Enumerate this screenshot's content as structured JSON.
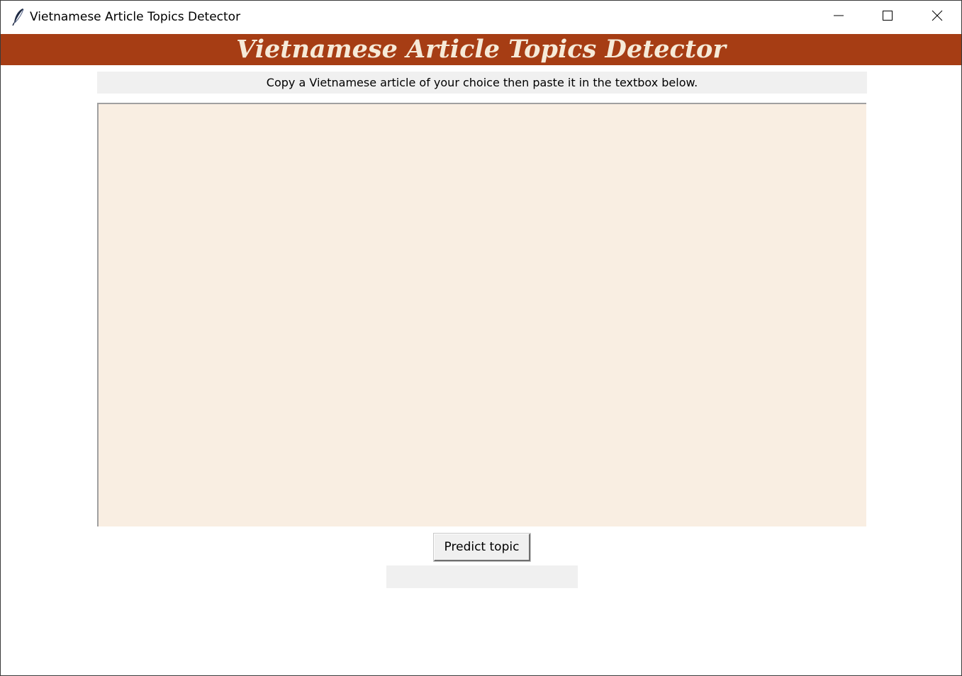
{
  "window": {
    "title": "Vietnamese Article Topics Detector",
    "icon": "feather-icon",
    "controls": {
      "minimize_icon": "minimize-icon",
      "maximize_icon": "maximize-icon",
      "close_icon": "close-icon"
    }
  },
  "header": {
    "banner_text": "Vietnamese Article Topics Detector",
    "banner_color": "#a63d14",
    "banner_text_color": "#f6ead8"
  },
  "main": {
    "instruction": "Copy a Vietnamese article of your choice then paste it in the textbox below.",
    "textbox_value": "",
    "textbox_bg": "#f9eee2",
    "predict_button_label": "Predict topic",
    "result_text": ""
  }
}
